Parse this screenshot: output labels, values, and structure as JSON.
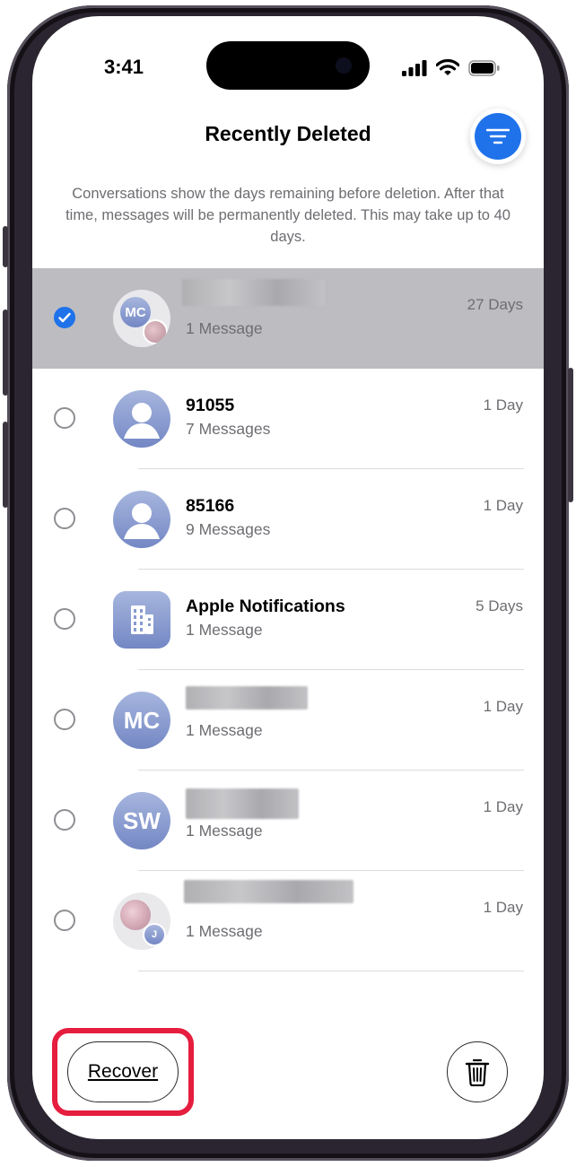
{
  "status_bar": {
    "time": "3:41"
  },
  "header": {
    "title": "Recently Deleted"
  },
  "info": {
    "text": "Conversations show the days remaining before deletion. After that time, messages will be permanently deleted. This may take up to 40 days."
  },
  "conversations": [
    {
      "name": "",
      "name_hidden": true,
      "subtitle": "1 Message",
      "days": "27 Days",
      "selected": true,
      "avatar": "group-mc",
      "avatar_initials": "MC"
    },
    {
      "name": "91055",
      "subtitle": "7 Messages",
      "days": "1 Day",
      "selected": false,
      "avatar": "person"
    },
    {
      "name": "85166",
      "subtitle": "9 Messages",
      "days": "1 Day",
      "selected": false,
      "avatar": "person"
    },
    {
      "name": "Apple Notifications",
      "subtitle": "1 Message",
      "days": "5 Days",
      "selected": false,
      "avatar": "building"
    },
    {
      "name": "",
      "name_hidden": true,
      "subtitle": "1 Message",
      "days": "1 Day",
      "selected": false,
      "avatar": "initials",
      "avatar_initials": "MC"
    },
    {
      "name": "",
      "name_hidden": true,
      "subtitle": "1 Message",
      "days": "1 Day",
      "selected": false,
      "avatar": "initials",
      "avatar_initials": "SW"
    },
    {
      "name": "",
      "name_hidden": true,
      "subtitle": "1 Message",
      "days": "1 Day",
      "selected": false,
      "avatar": "group-j",
      "avatar_initials": "J"
    }
  ],
  "toolbar": {
    "recover_label": "Recover"
  },
  "colors": {
    "accent": "#1f72ea",
    "highlight_outline": "#e51d3e",
    "selected_row": "#bdbcc1"
  },
  "icons": [
    "wifi-icon",
    "cellular-signal-icon",
    "battery-icon",
    "filter-icon",
    "checkmark-icon",
    "person-icon",
    "building-icon",
    "trash-icon"
  ]
}
